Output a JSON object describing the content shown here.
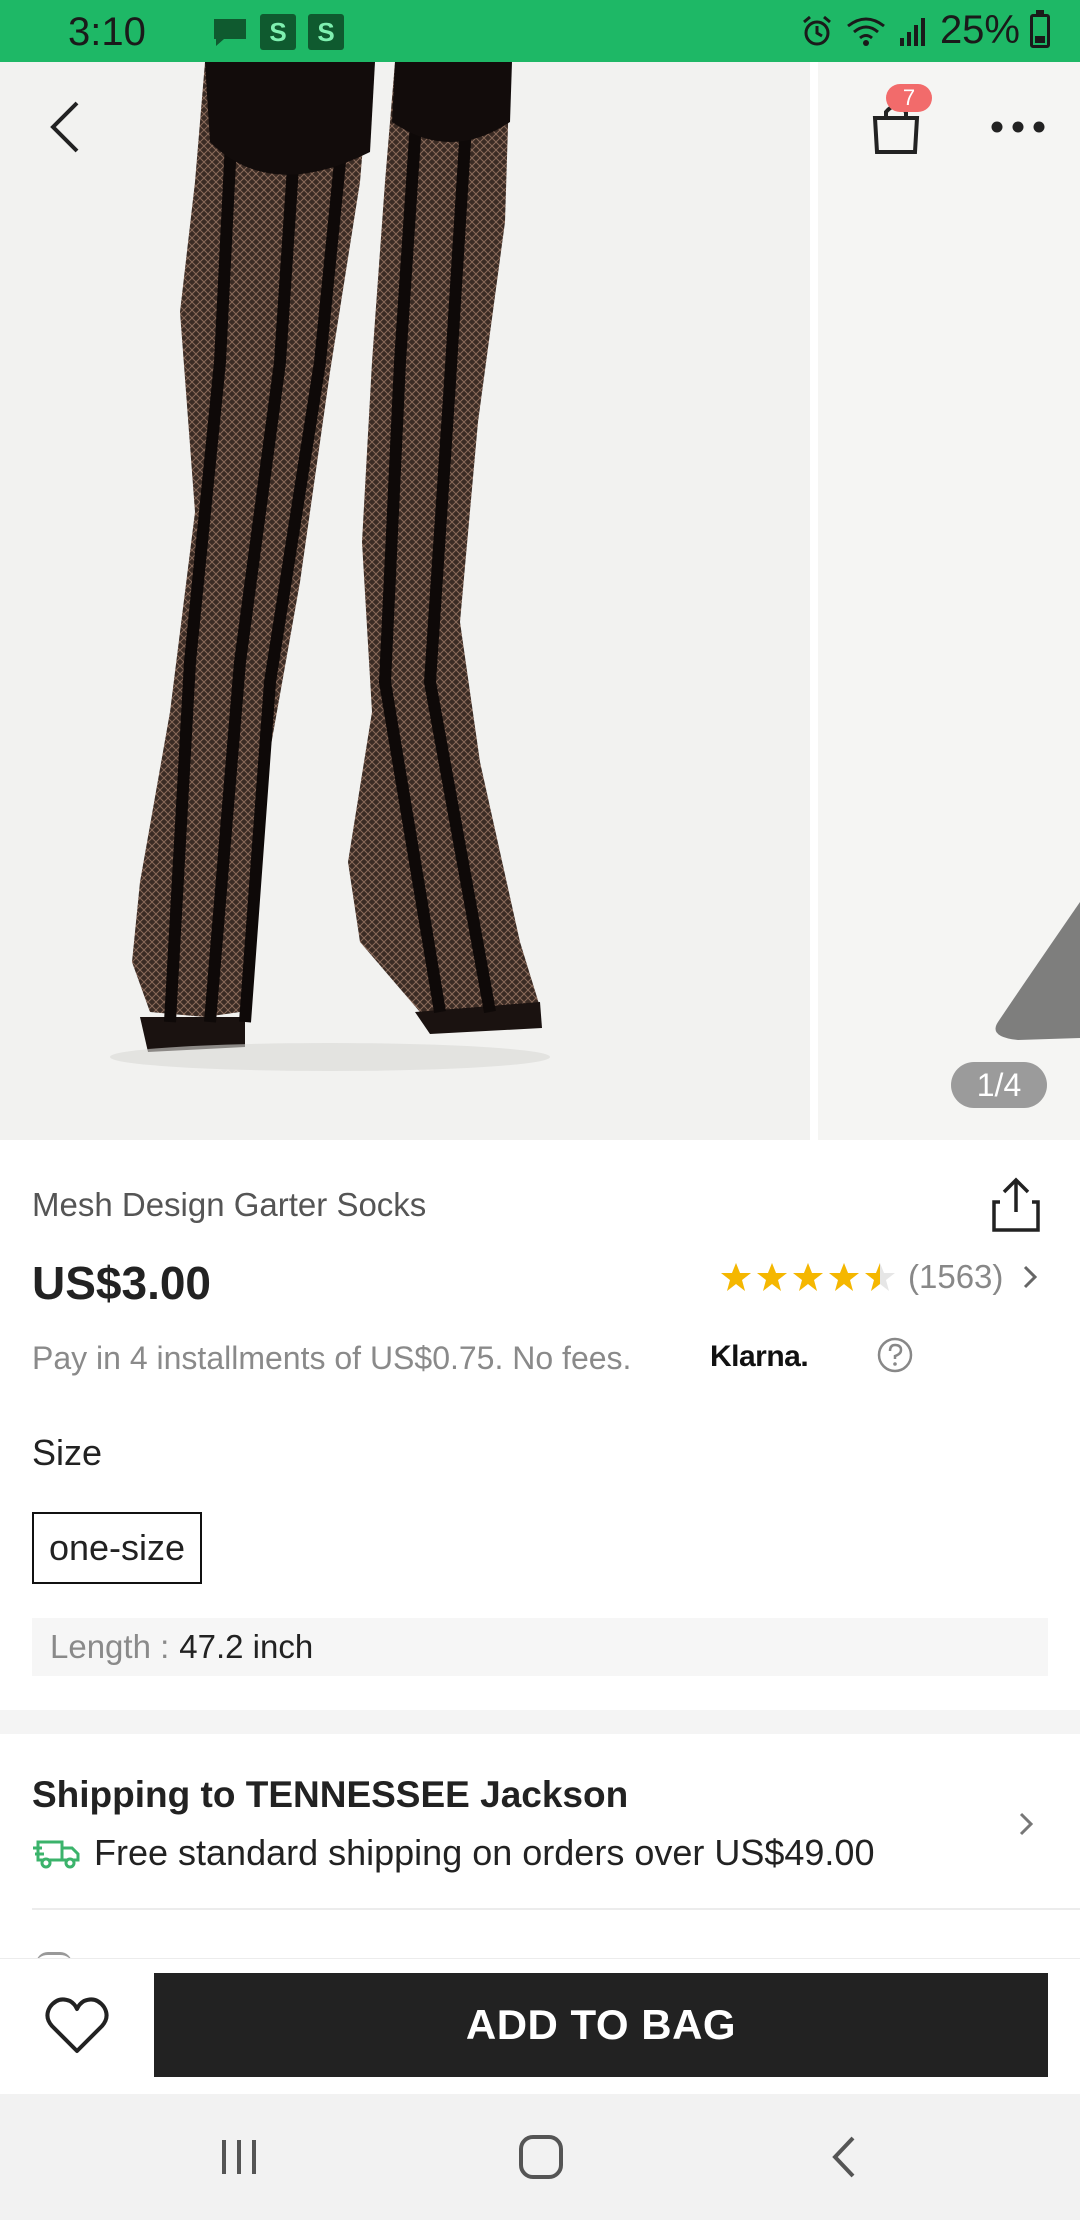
{
  "status_bar": {
    "time": "3:10",
    "battery": "25%",
    "notification_s1": "S",
    "notification_s2": "S"
  },
  "gallery": {
    "cart_count": "7",
    "page_indicator": "1/4"
  },
  "product": {
    "title": "Mesh Design Garter Socks",
    "price": "US$3.00",
    "rating_stars": 4.5,
    "rating_count": "(1563)",
    "installments": "Pay in 4 installments of US$0.75. No fees.",
    "klarna_label": "Klarna."
  },
  "size": {
    "label": "Size",
    "selected": "one-size",
    "length_key": "Length :",
    "length_value": "47.2 inch"
  },
  "shipping": {
    "title": "Shipping to TENNESSEE Jackson",
    "free_text": "Free standard shipping on orders over US$49.00"
  },
  "actions": {
    "add_to_bag": "ADD TO BAG"
  },
  "colors": {
    "status_bar": "#1eb866",
    "badge": "#f26b6b",
    "star": "#f5b700",
    "button": "#222222",
    "truck": "#3bb36b"
  }
}
